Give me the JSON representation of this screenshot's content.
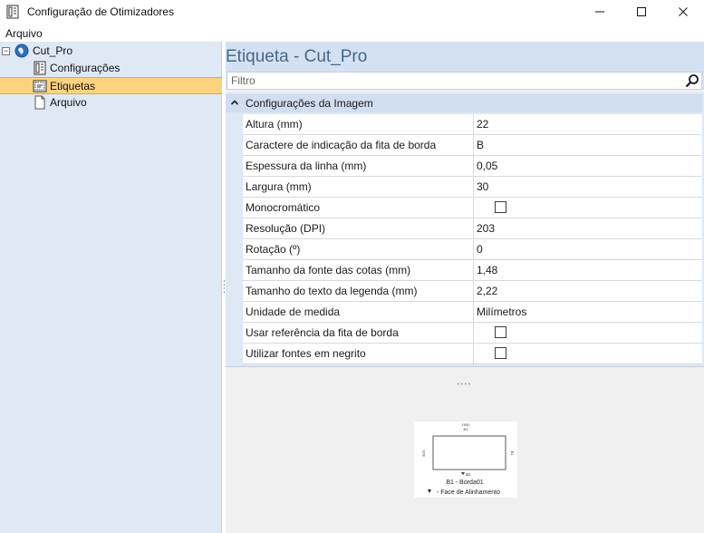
{
  "window": {
    "title": "Configuração de Otimizadores",
    "controls": {
      "minimize": "─",
      "maximize": "☐",
      "close": "✕"
    }
  },
  "menu": {
    "items": [
      {
        "label": "Arquivo"
      }
    ]
  },
  "tree": {
    "expander": "−",
    "root": {
      "label": "Cut_Pro"
    },
    "children": [
      {
        "label": "Configurações",
        "icon": "settings-form-icon"
      },
      {
        "label": "Etiquetas",
        "icon": "label-icon",
        "selected": true
      },
      {
        "label": "Arquivo",
        "icon": "file-icon"
      }
    ]
  },
  "main": {
    "title": "Etiqueta - Cut_Pro",
    "filter": {
      "placeholder": "Filtro",
      "value": ""
    },
    "category": {
      "label": "Configurações da Imagem"
    },
    "properties": [
      {
        "name": "Altura (mm)",
        "value": "22"
      },
      {
        "name": "Caractere de indicação da fita de borda",
        "value": "B"
      },
      {
        "name": "Espessura da linha (mm)",
        "value": "0,05"
      },
      {
        "name": "Largura (mm)",
        "value": "30"
      },
      {
        "name": "Monocromático",
        "value": "",
        "checkbox": true,
        "checked": false
      },
      {
        "name": "Resolução (DPI)",
        "value": "203"
      },
      {
        "name": "Rotação (º)",
        "value": "0"
      },
      {
        "name": "Tamanho da fonte das cotas (mm)",
        "value": "1,48"
      },
      {
        "name": "Tamanho do texto da legenda (mm)",
        "value": "2,22"
      },
      {
        "name": "Unidade de medida",
        "value": "Milímetros"
      },
      {
        "name": "Usar referência da fita de borda",
        "value": "",
        "checkbox": true,
        "checked": false
      },
      {
        "name": "Utilizar fontes em negrito",
        "value": "",
        "checkbox": true,
        "checked": false
      }
    ]
  },
  "preview": {
    "top_dimension": "1000",
    "top_edge": "B1",
    "left_dimension": "B15",
    "right_edge": "B1",
    "bottom_edge": "B1",
    "legend_line1": "B1 - Borda01",
    "legend_line2": "- Face de Alinhamento"
  }
}
